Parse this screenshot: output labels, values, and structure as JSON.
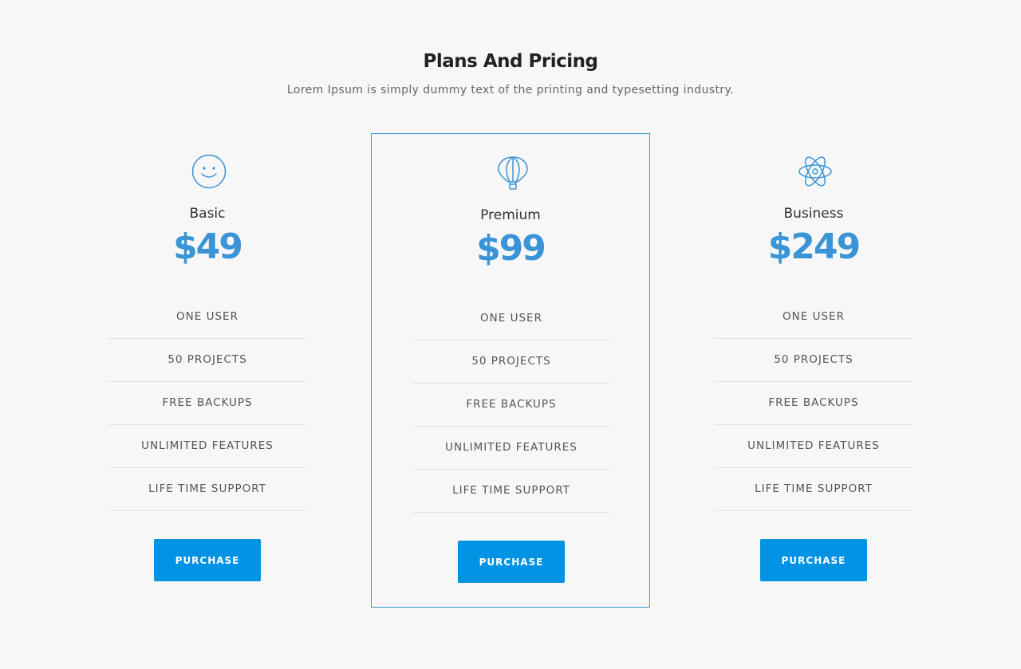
{
  "header": {
    "title": "Plans And Pricing",
    "subtitle": "Lorem Ipsum is simply dummy text of the printing and typesetting industry."
  },
  "theme": {
    "accent": "#3a94d6",
    "button": "#0093e4",
    "background": "#f7f7f7"
  },
  "plans": [
    {
      "icon": "smiley-icon",
      "name": "Basic",
      "price": "$49",
      "features": [
        "ONE USER",
        "50 PROJECTS",
        "FREE BACKUPS",
        "UNLIMITED FEATURES",
        "LIFE TIME SUPPORT"
      ],
      "button_label": "PURCHASE"
    },
    {
      "icon": "hot-air-balloon-icon",
      "name": "Premium",
      "price": "$99",
      "features": [
        "ONE USER",
        "50 PROJECTS",
        "FREE BACKUPS",
        "UNLIMITED FEATURES",
        "LIFE TIME SUPPORT"
      ],
      "button_label": "PURCHASE",
      "featured": true
    },
    {
      "icon": "atom-icon",
      "name": "Business",
      "price": "$249",
      "features": [
        "ONE USER",
        "50 PROJECTS",
        "FREE BACKUPS",
        "UNLIMITED FEATURES",
        "LIFE TIME SUPPORT"
      ],
      "button_label": "PURCHASE"
    }
  ]
}
